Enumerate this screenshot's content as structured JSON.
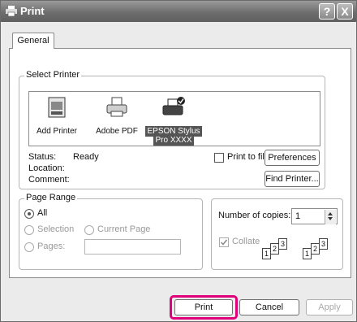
{
  "window": {
    "title": "Print",
    "help_label": "?",
    "close_label": "X"
  },
  "tabs": [
    {
      "label": "General"
    }
  ],
  "select_printer": {
    "group_label": "Select Printer",
    "printers": [
      {
        "label": "Add Printer",
        "icon": "add-printer-icon"
      },
      {
        "label": "Adobe PDF",
        "icon": "printer-icon"
      },
      {
        "label_line1": "EPSON Stylus",
        "label_line2": "Pro XXXX",
        "icon": "default-printer-icon",
        "selected": true
      }
    ],
    "status_label": "Status:",
    "status_value": "Ready",
    "location_label": "Location:",
    "comment_label": "Comment:",
    "print_to_file_label": "Print to file",
    "preferences_label": "Preferences",
    "find_printer_label": "Find Printer..."
  },
  "page_range": {
    "group_label": "Page Range",
    "all_label": "All",
    "selection_label": "Selection",
    "current_page_label": "Current Page",
    "pages_label": "Pages:",
    "pages_value": ""
  },
  "copies": {
    "number_label": "Number of copies:",
    "number_value": "1",
    "collate_label": "Collate",
    "collate_checked": true,
    "sheet_numbers": [
      "1",
      "2",
      "3"
    ]
  },
  "footer": {
    "print_label": "Print",
    "cancel_label": "Cancel",
    "apply_label": "Apply"
  },
  "colors": {
    "highlight": "#e0007a",
    "titlebar": "#6e6e6e"
  }
}
